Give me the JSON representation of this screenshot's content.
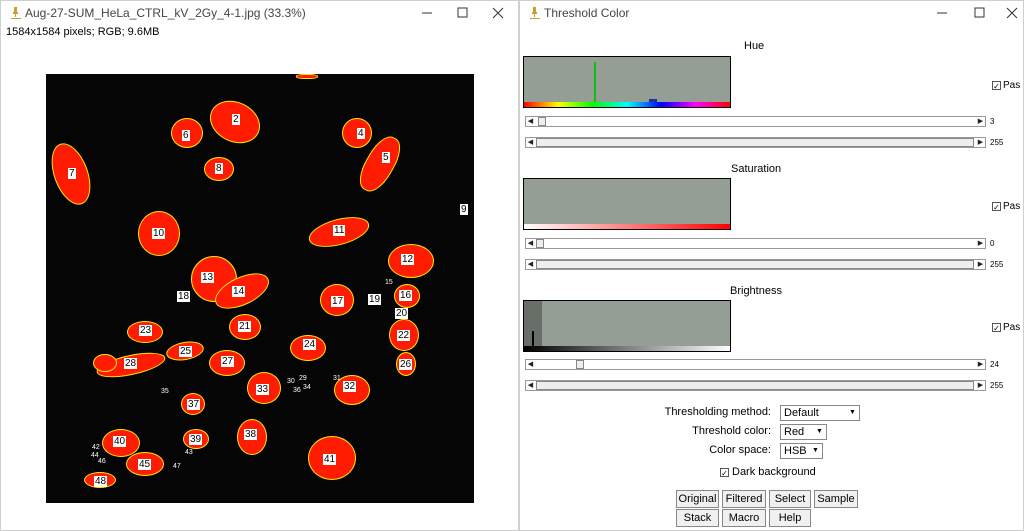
{
  "left_window": {
    "title": "Aug-27-SUM_HeLa_CTRL_kV_2Gy_4-1.jpg (33.3%)",
    "info": "1584x1584 pixels; RGB; 9.6MB",
    "cell_labels": [
      "2",
      "6",
      "4",
      "5",
      "7",
      "8",
      "9",
      "10",
      "11",
      "12",
      "13",
      "14",
      "15",
      "16",
      "17",
      "18",
      "19",
      "20",
      "21",
      "22",
      "23",
      "24",
      "25",
      "26",
      "27",
      "28",
      "29",
      "30",
      "31",
      "32",
      "33",
      "34",
      "35",
      "36",
      "37",
      "38",
      "39",
      "40",
      "41",
      "42",
      "43",
      "44",
      "45",
      "46",
      "47",
      "48"
    ]
  },
  "right_window": {
    "title": "Threshold Color",
    "hue": {
      "title": "Hue",
      "min_value": "3",
      "max_value": "255",
      "pass_label": "Pas"
    },
    "saturation": {
      "title": "Saturation",
      "min_value": "0",
      "max_value": "255",
      "pass_label": "Pas"
    },
    "brightness": {
      "title": "Brightness",
      "min_value": "24",
      "max_value": "255",
      "pass_label": "Pas"
    },
    "method_label": "Thresholding method:",
    "method_value": "Default",
    "color_label": "Threshold color:",
    "color_value": "Red",
    "space_label": "Color space:",
    "space_value": "HSB",
    "dark_bg_label": "Dark background",
    "buttons": {
      "original": "Original",
      "filtered": "Filtered",
      "select": "Select",
      "sample": "Sample",
      "stack": "Stack",
      "macro": "Macro",
      "help": "Help"
    }
  }
}
